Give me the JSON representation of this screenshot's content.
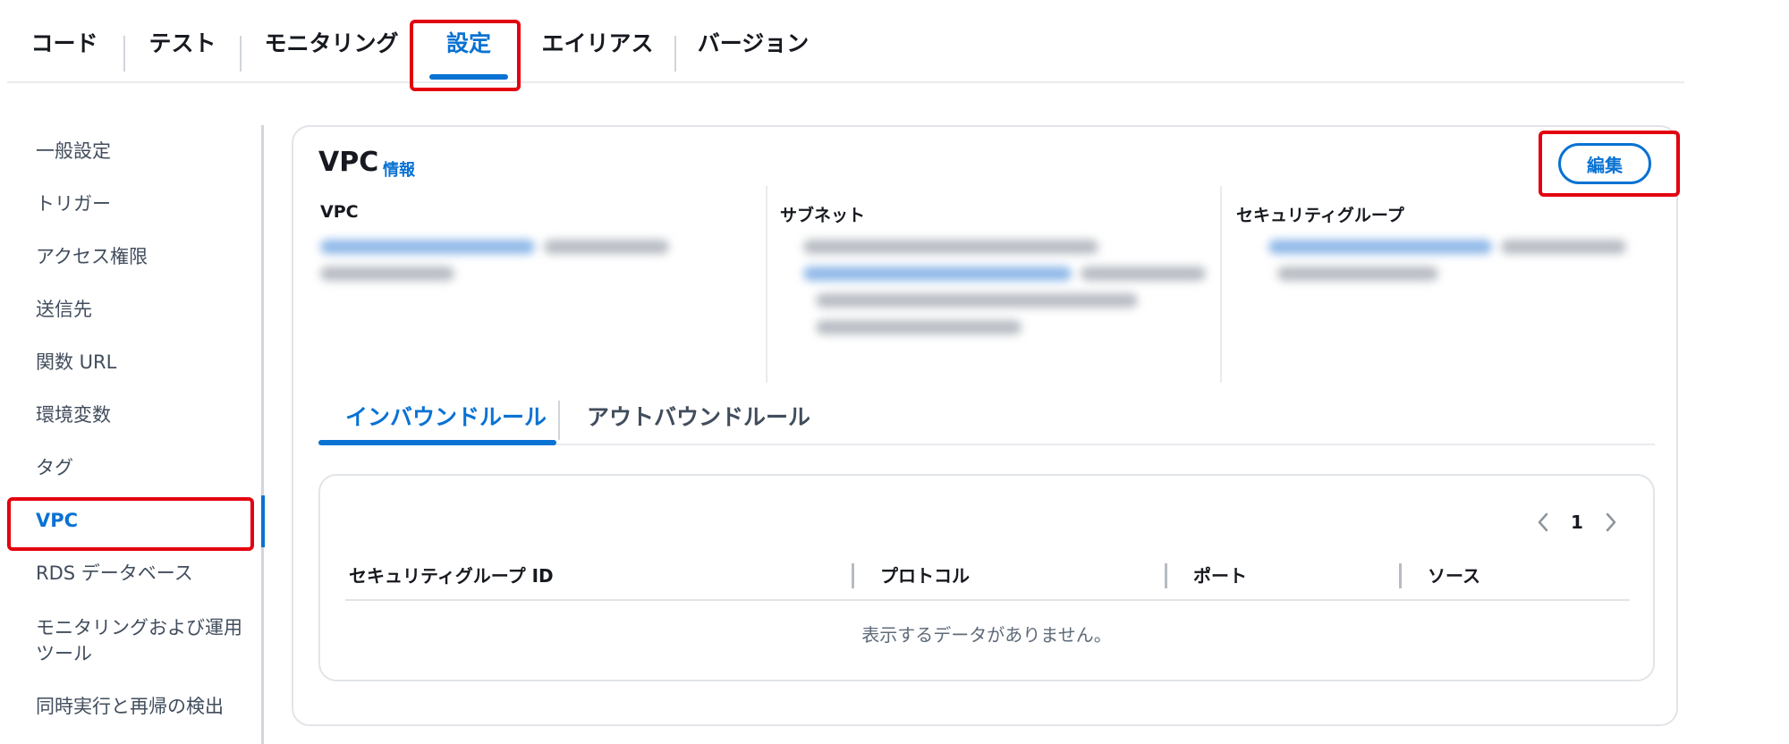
{
  "top_tabs": [
    {
      "label": "コード"
    },
    {
      "label": "テスト"
    },
    {
      "label": "モニタリング"
    },
    {
      "label": "設定"
    },
    {
      "label": "エイリアス"
    },
    {
      "label": "バージョン"
    }
  ],
  "active_top_tab": "設定",
  "sidebar": {
    "items": [
      {
        "label": "一般設定"
      },
      {
        "label": "トリガー"
      },
      {
        "label": "アクセス権限"
      },
      {
        "label": "送信先"
      },
      {
        "label": "関数 URL"
      },
      {
        "label": "環境変数"
      },
      {
        "label": "タグ"
      },
      {
        "label": "VPC"
      },
      {
        "label": "RDS データベース"
      },
      {
        "label": "モニタリングおよび運用ツール"
      },
      {
        "label": "同時実行と再帰の検出"
      }
    ],
    "active": "VPC"
  },
  "panel": {
    "title": "VPC",
    "info_link": "情報",
    "edit_button": "編集",
    "columns": {
      "vpc": "VPC",
      "subnet": "サブネット",
      "security_group": "セキュリティグループ"
    },
    "rule_tabs": {
      "inbound": "インバウンドルール",
      "outbound": "アウトバウンドルール"
    },
    "table": {
      "page": "1",
      "headers": {
        "sg_id": "セキュリティグループ ID",
        "protocol": "プロトコル",
        "port": "ポート",
        "source": "ソース"
      },
      "empty_message": "表示するデータがありません。"
    }
  },
  "colors": {
    "accent": "#0972d3",
    "highlight": "#e3000f",
    "text": "#16191f",
    "muted": "#5f6b7a"
  },
  "icons": [
    "chevron-left-icon",
    "chevron-right-icon"
  ]
}
